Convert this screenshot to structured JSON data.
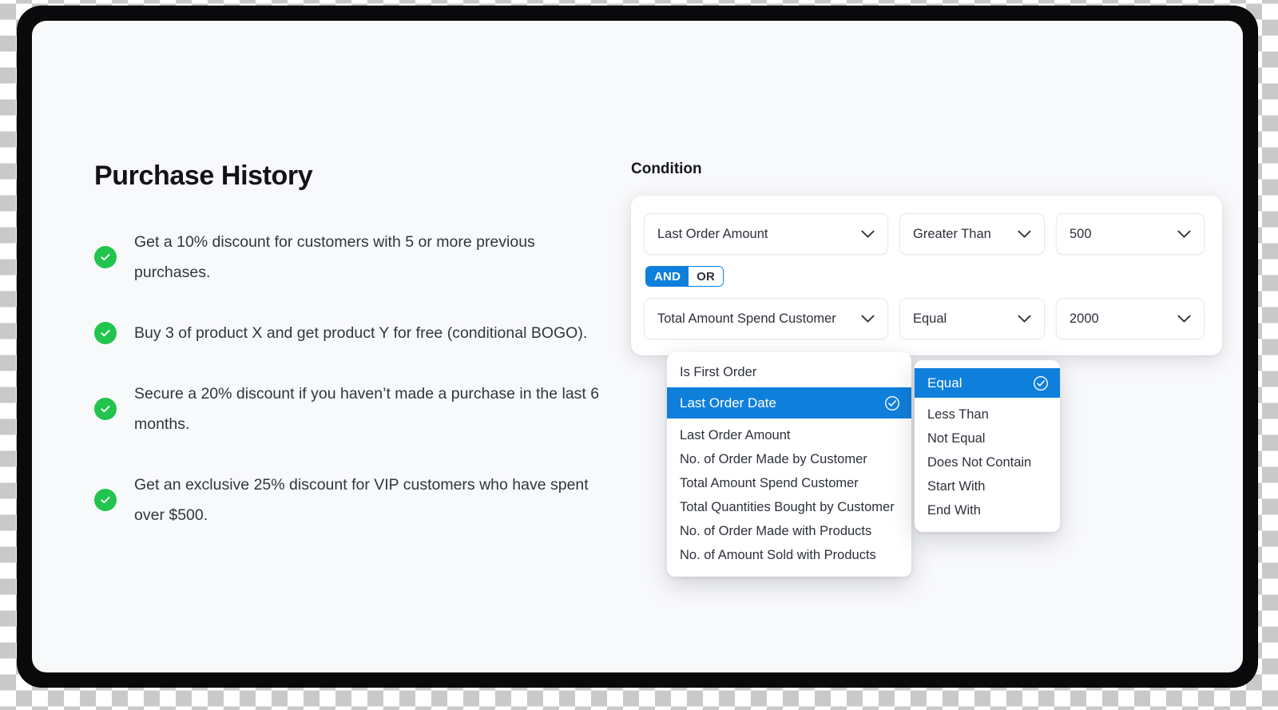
{
  "left_panel": {
    "title": "Purchase History",
    "benefits": [
      {
        "icon": "check-circle-icon",
        "text": "Get a 10% discount for customers with 5 or more previous purchases."
      },
      {
        "icon": "check-circle-icon",
        "text": "Buy 3 of product X and get product Y for free (conditional BOGO)."
      },
      {
        "icon": "check-circle-icon",
        "text": "Secure a 20% discount if you haven’t made a purchase in the last 6 months."
      },
      {
        "icon": "check-circle-icon",
        "text": "Get an exclusive 25% discount for VIP customers who have spent over $500."
      }
    ]
  },
  "condition_panel": {
    "label": "Condition",
    "rows": [
      {
        "field": "Last Order Amount",
        "operator": "Greater Than",
        "value": "500"
      },
      {
        "field": "Total Amount Spend Customer",
        "operator": "Equal",
        "value": "2000"
      }
    ],
    "logic_toggle": {
      "and_label": "AND",
      "or_label": "OR",
      "selected": "AND"
    },
    "field_dropdown": {
      "selected": "Last Order Date",
      "options": [
        "Is First Order",
        "Last Order Date",
        "Last Order Amount",
        "No. of Order Made by Customer",
        "Total Amount Spend Customer",
        "Total Quantities Bought by Customer",
        "No. of Order Made with Products",
        "No. of Amount Sold with Products"
      ]
    },
    "operator_dropdown": {
      "selected": "Equal",
      "options": [
        "Equal",
        "Less Than",
        "Not Equal",
        "Does Not Contain",
        "Start With",
        "End With"
      ]
    }
  },
  "colors": {
    "accent_blue": "#0f7fdc",
    "success_green": "#21c44d",
    "surface": "#f8f9fb",
    "frame": "#0a0a0c",
    "text": "#2c303a"
  }
}
